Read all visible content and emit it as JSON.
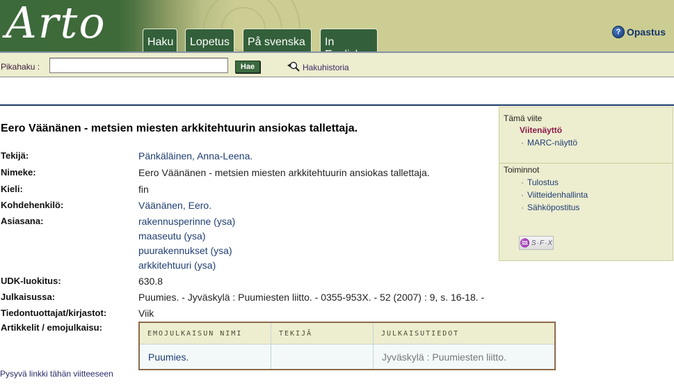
{
  "header": {
    "logo": "Arto",
    "tabs": [
      {
        "label": "Haku"
      },
      {
        "label": "Lopetus"
      },
      {
        "label": "På svenska"
      },
      {
        "label": "In English"
      }
    ],
    "help": {
      "label": "Opastus",
      "icon": "help-circle-icon"
    }
  },
  "search": {
    "label": "Pikahaku :",
    "value": "",
    "placeholder": "",
    "button_label": "Hae",
    "history_label": "Hakuhistoria",
    "history_icon": "magnifier-icon"
  },
  "record": {
    "title": "Eero Väänänen - metsien miesten arkkitehtuurin ansiokas tallettaja.",
    "fields": [
      {
        "label": "Tekijä:",
        "value": "Pänkäläinen, Anna-Leena.",
        "link": true
      },
      {
        "label": "Nimeke:",
        "value": "Eero Väänänen - metsien miesten arkkitehtuurin ansiokas tallettaja.",
        "link": false
      },
      {
        "label": "Kieli:",
        "value": "fin",
        "link": false
      },
      {
        "label": "Kohdehenkilö:",
        "value": "Väänänen, Eero.",
        "link": true
      },
      {
        "label": "Asiasana:",
        "values": [
          "rakennusperinne (ysa)",
          "maaseutu (ysa)",
          "puurakennukset (ysa)",
          "arkkitehtuuri (ysa)"
        ],
        "link": true
      },
      {
        "label": "UDK-luokitus:",
        "value": "630.8",
        "link": false
      },
      {
        "label": "Julkaisussa:",
        "value": "Puumies. - Jyväskylä : Puumiesten liitto. - 0355-953X. - 52 (2007) : 9, s. 16-18. -",
        "link": false
      },
      {
        "label": "Tiedontuottajat/kirjastot:",
        "value": "Viik",
        "link": false
      },
      {
        "label": "Artikkelit / emojulkaisu:"
      }
    ],
    "parent_table": {
      "columns": [
        "EMOJULKAISUN NIMI",
        "TEKIJÄ",
        "JULKAISUTIEDOT"
      ],
      "rows": [
        [
          "Puumies.",
          "",
          "Jyväskylä : Puumiesten liitto."
        ]
      ]
    },
    "permalink": "Pysyvä linkki tähän viitteeseen"
  },
  "panel": {
    "section1": {
      "heading": "Tämä viite",
      "active": "Viitenäyttö",
      "items": [
        "MARC-näyttö"
      ]
    },
    "section2": {
      "heading": "Toiminnot",
      "items": [
        "Tulostus",
        "Viitteidenhallinta",
        "Sähköpostitus"
      ]
    },
    "sfx_label": "S·F·X"
  },
  "colors": {
    "header_green": "#3d6a3a",
    "header_khaki": "#cccd93",
    "bar_bg": "#ededcf",
    "link": "#1f3e73",
    "active": "#8a1a4a"
  }
}
